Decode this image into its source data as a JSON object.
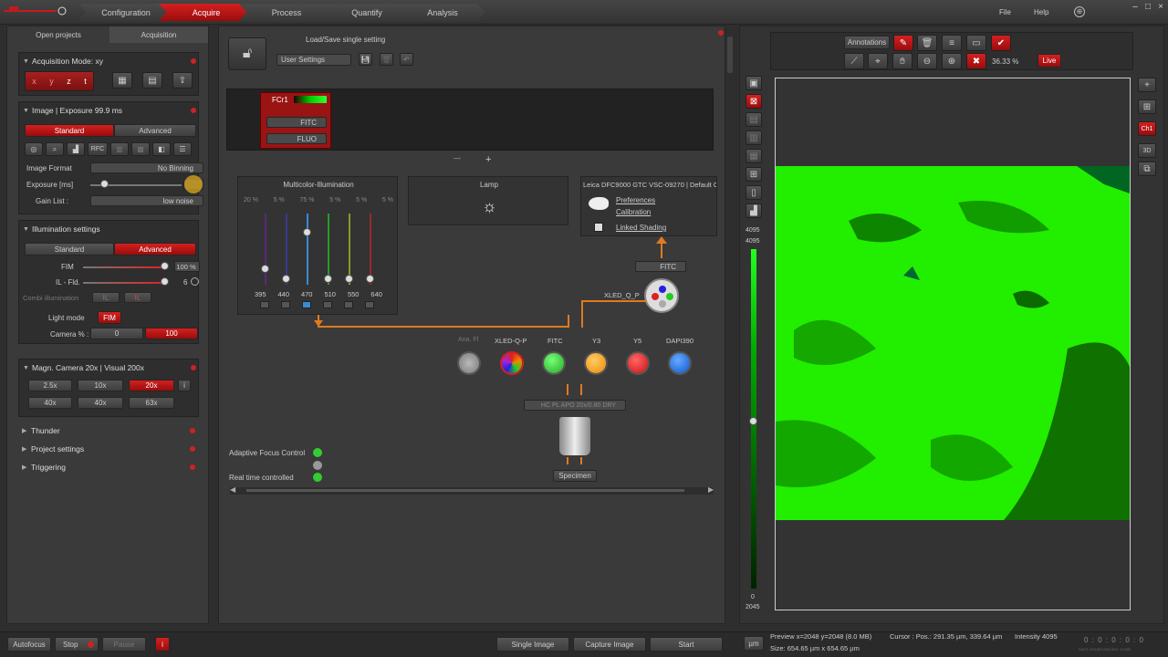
{
  "nav": {
    "tabs": [
      {
        "label": "Configuration"
      },
      {
        "label": "Acquire"
      },
      {
        "label": "Process"
      },
      {
        "label": "Quantify"
      },
      {
        "label": "Analysis"
      }
    ],
    "file": "File",
    "help": "Help"
  },
  "left": {
    "tab_projects": "Open projects",
    "tab_acquisition": "Acquisition",
    "acq_mode": {
      "title": "Acquisition Mode: xy",
      "axes": [
        "x",
        "y",
        "z",
        "t"
      ]
    },
    "image": {
      "title": "Image | Exposure 99.9 ms",
      "standard": "Standard",
      "advanced": "Advanced",
      "rfc": "RFC",
      "format_label": "Image Format",
      "format_value": "No Binning",
      "exposure_label": "Exposure [ms]",
      "gain_label": "Gain List :",
      "gain_value": "low noise"
    },
    "illum": {
      "title": "Illumination settings",
      "standard": "Standard",
      "advanced": "Advanced",
      "fim_label": "FIM",
      "fim_value": "100 %",
      "fim_level": 1.0,
      "il_label": "IL - Fld.",
      "il_value": "6",
      "combi_label": "Combi illumination",
      "combi_a": "IL",
      "combi_b": "IL",
      "light_mode_label": "Light mode",
      "light_mode_value": "FIM",
      "camera_label": "Camera % :",
      "camera_left": "0",
      "camera_right": "100"
    },
    "magn": {
      "title": "Magn. Camera 20x | Visual 200x",
      "row1": [
        "2.5x",
        "10x",
        "20x"
      ],
      "row2": [
        "40x",
        "40x",
        "63x"
      ]
    },
    "thunder": "Thunder",
    "project_settings": "Project settings",
    "triggering": "Triggering"
  },
  "center": {
    "load_save": "Load/Save single setting",
    "user_settings": "User Settings",
    "fc_label": "FCr1",
    "fitc_select": "FITC",
    "fluo_select": "FLUO",
    "multicolor_title": "Multicolor-Illumination",
    "percents": [
      "20 %",
      "5 %",
      "75 %",
      "5 %",
      "5 %",
      "5 %"
    ],
    "wavelengths": [
      "395",
      "440",
      "470",
      "510",
      "550",
      "640"
    ],
    "lamp_title": "Lamp",
    "camera_title": "Leica DFC9000 GTC VSC-09270 | Default C",
    "preferences": "Preferences",
    "calibration": "Calibration",
    "linked_shading": "Linked Shading",
    "fitc_turret": "FITC",
    "xled_label": "XLED_Q_P",
    "filters": [
      {
        "label": "Ana. Fl",
        "color": "#9a9a9a"
      },
      {
        "label": "XLED-Q-P",
        "color": "multi"
      },
      {
        "label": "FITC",
        "color": "#2ecc2e"
      },
      {
        "label": "Y3",
        "color": "#f39c12"
      },
      {
        "label": "Y5",
        "color": "#e52020"
      },
      {
        "label": "DAPI390",
        "color": "#2d7be5"
      }
    ],
    "objective": "HC PL APO 20x/0.80 DRY",
    "specimen": "Specimen",
    "adaptive_focus": "Adaptive Focus Control",
    "real_time": "Real time controlled"
  },
  "viewer": {
    "annotations": "Annotations",
    "zoom": "36.33 %",
    "live": "Live",
    "ch1": "Ch1",
    "three_d": "3D",
    "hist_top": "4095",
    "hist_top2": "4095",
    "hist_bottom": "0",
    "hist_bottom2": "2045"
  },
  "status": {
    "autofocus": "Autofocus",
    "stop": "Stop",
    "pause": "Pause",
    "single_image": "Single Image",
    "capture_image": "Capture Image",
    "start": "Start",
    "um": "µm",
    "preview": "Preview x=2048 y=2048 (8.0 MB)",
    "size": "Size: 654.65 µm x 654.65 µm",
    "cursor": "Cursor : Pos.: 291.35 µm, 339.64 µm",
    "intensity": "Intensity 4095",
    "clock": "0 : 0 : 0 : 0 : 0",
    "clock_units": "DAYS  HOURS  MIN  SEC  1/1000"
  },
  "colors": {
    "accent": "#c41a1a",
    "green": "#22ee00",
    "orange": "#e07a1f"
  }
}
